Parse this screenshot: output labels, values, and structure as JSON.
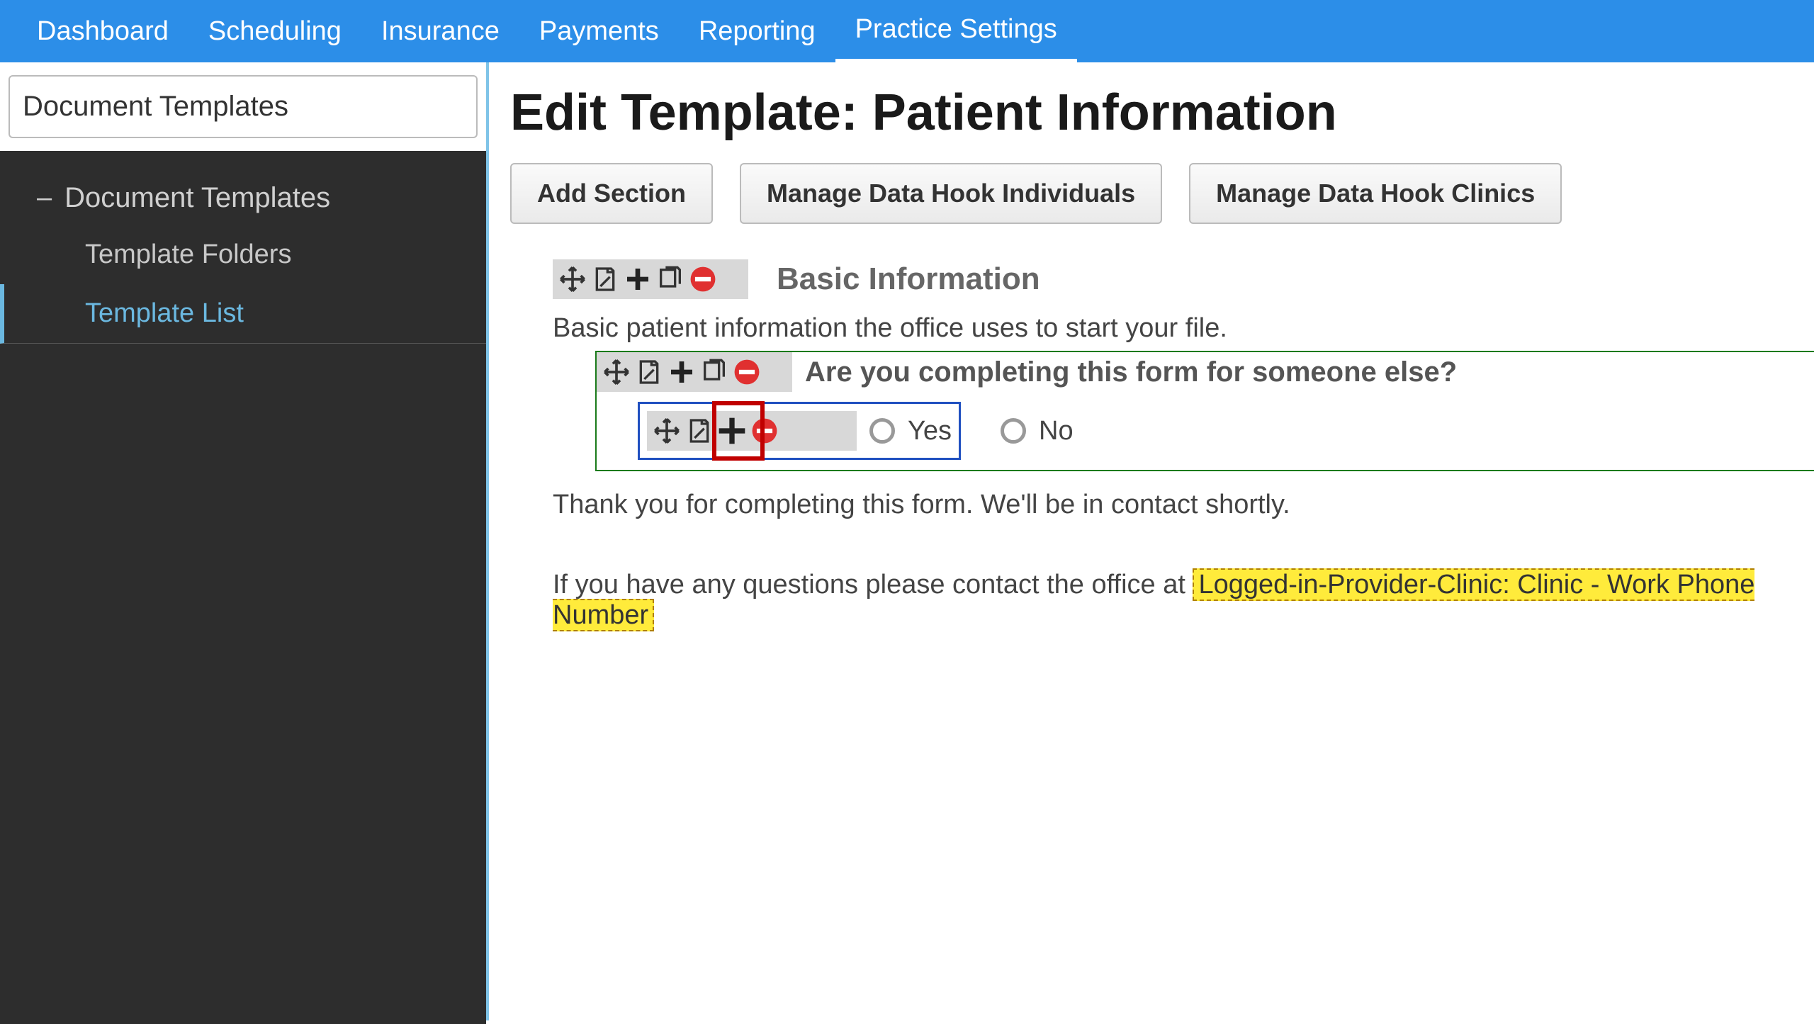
{
  "nav": {
    "items": [
      "Dashboard",
      "Scheduling",
      "Insurance",
      "Payments",
      "Reporting",
      "Practice Settings"
    ],
    "active_index": 5
  },
  "sidebar": {
    "header": "Document Templates",
    "parent": "Document Templates",
    "children": [
      "Template Folders",
      "Template List"
    ],
    "active_child_index": 1
  },
  "main": {
    "title": "Edit Template: Patient Information",
    "buttons": {
      "add_section": "Add Section",
      "manage_individuals": "Manage Data Hook Individuals",
      "manage_clinics": "Manage Data Hook Clinics"
    },
    "section": {
      "title": "Basic Information",
      "description": "Basic patient information the office uses to start your file.",
      "question": "Are you completing this form for someone else?",
      "options": {
        "yes": "Yes",
        "no": "No"
      }
    },
    "footer1": "Thank you for completing this form. We'll be in contact shortly.",
    "footer2_prefix": "If you have any questions please contact the office at ",
    "footer2_hook": "Logged-in-Provider-Clinic: Clinic - Work Phone Number"
  },
  "icons": {
    "move": "move-icon",
    "edit": "edit-icon",
    "plus": "plus-icon",
    "copy": "copy-icon",
    "remove": "remove-icon"
  },
  "colors": {
    "primary": "#2c8ee8",
    "sidebar_bg": "#2d2d2d",
    "active_link": "#6bb8e0",
    "highlight_border": "#c00000",
    "green_border": "#1a7a1a",
    "blue_border": "#2050c0",
    "yellow_bg": "#ffeb3b"
  }
}
